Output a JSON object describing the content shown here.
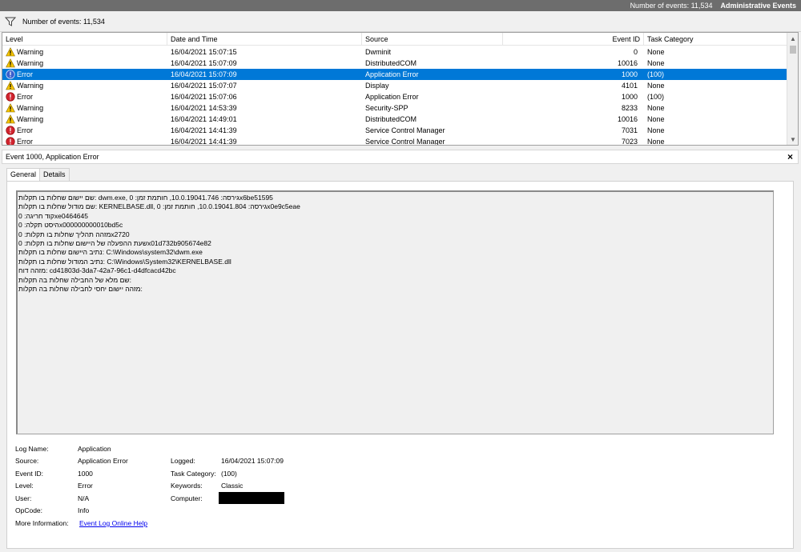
{
  "titlebar": {
    "event_count": "Number of events: 11,534",
    "view_name": "Administrative Events"
  },
  "filterbar": {
    "icon": "filter-icon",
    "text": "Number of events: 11,534"
  },
  "grid": {
    "columns": {
      "level": "Level",
      "date": "Date and Time",
      "source": "Source",
      "event_id": "Event ID",
      "category": "Task Category"
    },
    "rows": [
      {
        "icon": "warning-icon",
        "level": "Warning",
        "date": "16/04/2021 15:07:15",
        "source": "Dwminit",
        "event_id": "0",
        "category": "None"
      },
      {
        "icon": "warning-icon",
        "level": "Warning",
        "date": "16/04/2021 15:07:09",
        "source": "DistributedCOM",
        "event_id": "10016",
        "category": "None"
      },
      {
        "icon": "error-icon",
        "level": "Error",
        "date": "16/04/2021 15:07:09",
        "source": "Application Error",
        "event_id": "1000",
        "category": "(100)",
        "selected": true
      },
      {
        "icon": "warning-icon",
        "level": "Warning",
        "date": "16/04/2021 15:07:07",
        "source": "Display",
        "event_id": "4101",
        "category": "None"
      },
      {
        "icon": "error-icon",
        "level": "Error",
        "date": "16/04/2021 15:07:06",
        "source": "Application Error",
        "event_id": "1000",
        "category": "(100)"
      },
      {
        "icon": "warning-icon",
        "level": "Warning",
        "date": "16/04/2021 14:53:39",
        "source": "Security-SPP",
        "event_id": "8233",
        "category": "None"
      },
      {
        "icon": "warning-icon",
        "level": "Warning",
        "date": "16/04/2021 14:49:01",
        "source": "DistributedCOM",
        "event_id": "10016",
        "category": "None"
      },
      {
        "icon": "error-icon",
        "level": "Error",
        "date": "16/04/2021 14:41:39",
        "source": "Service Control Manager",
        "event_id": "7031",
        "category": "None"
      },
      {
        "icon": "error-icon",
        "level": "Error",
        "date": "16/04/2021 14:41:39",
        "source": "Service Control Manager",
        "event_id": "7023",
        "category": "None"
      }
    ]
  },
  "detail": {
    "title": "Event 1000, Application Error",
    "close": "×",
    "tabs": [
      "General",
      "Details"
    ],
    "description_lines": [
      "שם יישום שחלות בו תקלות: dwm.exe, גירסה: 10.0.19041.746, חותמת זמן: 0x6be51595",
      "שם מודול שחלות בו תקלות: KERNELBASE.dll, גירסה: 10.0.19041.804, חותמת זמן: 0x0e9c5eae",
      "קוד חריגה: 0xe0464645",
      "היסט תקלה: 0x000000000010bd5c",
      "מזהה תהליך שחלות בו תקלות: 0x2720",
      "שעת ההפעלה של היישום שחלות בו תקלות: 0x01d732b905674e82",
      "נתיב היישום שחלות בו תקלות: C:\\Windows\\system32\\dwm.exe",
      "נתיב המודול שחלות בו תקלות: C:\\Windows\\System32\\KERNELBASE.dll",
      "מזהה דוח: cd41803d-3da7-42a7-96c1-d4dfcacd42bc",
      "שם מלא של החבילה שחלות בה תקלות:",
      "מזהה יישום יחסי לחבילה שחלות בה תקלות:"
    ],
    "props": {
      "log_name_label": "Log Name:",
      "log_name": "Application",
      "source_label": "Source:",
      "source": "Application Error",
      "logged_label": "Logged:",
      "logged": "16/04/2021 15:07:09",
      "event_id_label": "Event ID:",
      "event_id": "1000",
      "task_category_label": "Task Category:",
      "task_category": "(100)",
      "level_label": "Level:",
      "level": "Error",
      "keywords_label": "Keywords:",
      "keywords": "Classic",
      "user_label": "User:",
      "user": "N/A",
      "computer_label": "Computer:",
      "opcode_label": "OpCode:",
      "opcode": "Info",
      "more_info_label": "More Information:",
      "more_info_link": "Event Log Online Help"
    }
  },
  "colors": {
    "selection": "#0078d7",
    "titlebar": "#6d6d6d",
    "link": "#0000ee"
  }
}
